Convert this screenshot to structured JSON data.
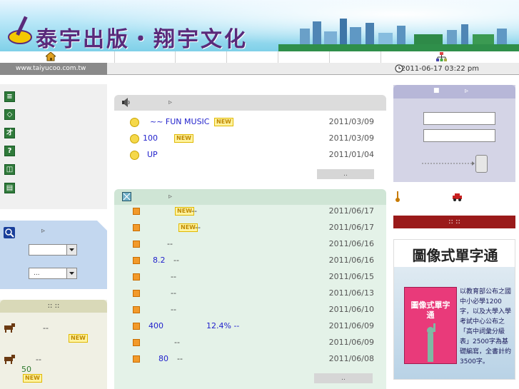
{
  "header": {
    "site_title": "泰宇出版・翔宇文化"
  },
  "nav": {
    "home_icon": "home-icon",
    "sitemap_icon": "sitemap-icon"
  },
  "statusbar": {
    "url": "www.taiyucoo.com.tw",
    "datetime": "2011-06-17 03:22 pm",
    "clock_icon": "clock-icon"
  },
  "left_nav": {
    "icons": [
      "list-icon",
      "tag-icon",
      "book-icon",
      "question-icon",
      "window-icon",
      "page-icon"
    ]
  },
  "search": {
    "arrow": "▹",
    "select1_value": "",
    "select2_value": "..."
  },
  "left_bottom": {
    "header": "::          ::",
    "items": [
      {
        "text": "--",
        "new": "NEW"
      },
      {
        "text": "--",
        "number": "50",
        "new": "NEW"
      }
    ]
  },
  "announcements": {
    "arrow": "▹",
    "more": "..",
    "rows": [
      {
        "title": "~~ FUN MUSIC",
        "new": "NEW",
        "date": "2011/03/09"
      },
      {
        "title": "100",
        "new": "NEW",
        "date": "2011/03/09"
      },
      {
        "title": "UP",
        "new": "",
        "date": "2011/01/04"
      }
    ]
  },
  "news": {
    "arrow": "▹",
    "more": "..",
    "rows": [
      {
        "title": "",
        "new": "NEW",
        "suffix": "--",
        "date": "2011/06/17"
      },
      {
        "title": "",
        "new": "NEW",
        "suffix": "--",
        "date": "2011/06/17"
      },
      {
        "title": "--",
        "new": "",
        "suffix": "",
        "date": "2011/06/16"
      },
      {
        "title": "8.2",
        "new": "",
        "suffix": "--",
        "date": "2011/06/16"
      },
      {
        "title": "--",
        "new": "",
        "suffix": "",
        "date": "2011/06/15"
      },
      {
        "title": "--",
        "new": "",
        "suffix": "",
        "date": "2011/06/13"
      },
      {
        "title": "--",
        "new": "",
        "suffix": "",
        "date": "2011/06/10"
      },
      {
        "title": "400",
        "new": "",
        "suffix": "12.4% --",
        "date": "2011/06/09"
      },
      {
        "title": "--",
        "new": "",
        "suffix": "",
        "date": "2011/06/09"
      },
      {
        "title": "80",
        "new": "",
        "suffix": "--",
        "date": "2011/06/08"
      }
    ]
  },
  "login": {
    "header_bullet": "■",
    "arrow": "▹",
    "username_value": "",
    "password_value": ""
  },
  "ad": {
    "header": "::       ::",
    "title": "圖像式單字通",
    "book_title": "圖像式單字通",
    "description": "以教育部公布之國中小必學1200字，以及大學入學考試中心公布之「高中詞彙分級表」2500字為基礎編寫，全書計約3500字。"
  },
  "colors": {
    "announce_header": "#dcdcdc",
    "news_header": "#cfe5d5",
    "news_body": "#e4f2e8",
    "login_bg": "#d4d4e6",
    "ad_header": "#9a1a1a"
  }
}
